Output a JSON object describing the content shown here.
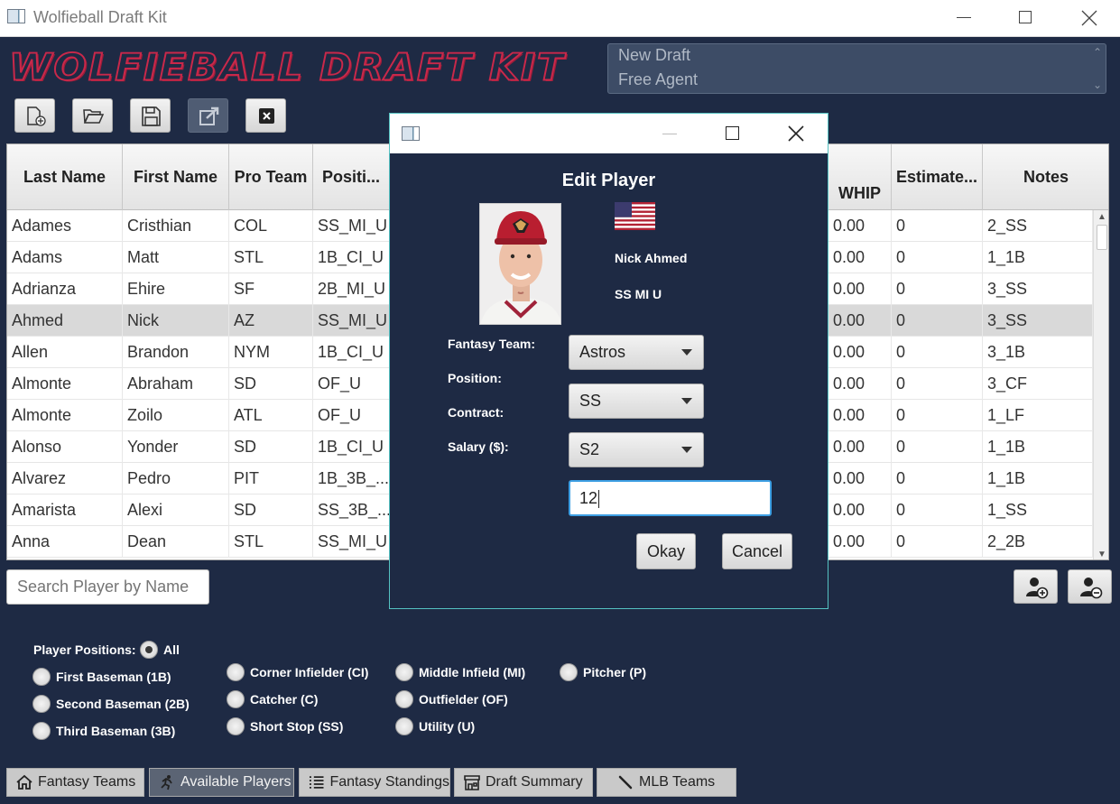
{
  "window": {
    "title": "Wolfieball Draft Kit"
  },
  "logo": {
    "text": "WOLFIEBALL DRAFT KIT"
  },
  "draft_list": {
    "items": [
      "New Draft",
      "Free Agent"
    ]
  },
  "toolbar": {
    "buttons": [
      "new-draft",
      "open-draft",
      "save-draft",
      "export-draft",
      "exit"
    ]
  },
  "table": {
    "headers": {
      "last_name": "Last Name",
      "first_name": "First Name",
      "pro_team": "Pro Team",
      "positions": "Positi...",
      "whip": "WHIP",
      "estimated": "Estimate...",
      "notes": "Notes"
    },
    "rows": [
      {
        "last": "Adames",
        "first": "Cristhian",
        "team": "COL",
        "pos": "SS_MI_U",
        "whip": "0.00",
        "est": "0",
        "notes": "2_SS"
      },
      {
        "last": "Adams",
        "first": "Matt",
        "team": "STL",
        "pos": "1B_CI_U",
        "whip": "0.00",
        "est": "0",
        "notes": "1_1B"
      },
      {
        "last": "Adrianza",
        "first": "Ehire",
        "team": "SF",
        "pos": "2B_MI_U",
        "whip": "0.00",
        "est": "0",
        "notes": "3_SS"
      },
      {
        "last": "Ahmed",
        "first": "Nick",
        "team": "AZ",
        "pos": "SS_MI_U",
        "whip": "0.00",
        "est": "0",
        "notes": "3_SS"
      },
      {
        "last": "Allen",
        "first": "Brandon",
        "team": "NYM",
        "pos": "1B_CI_U",
        "whip": "0.00",
        "est": "0",
        "notes": "3_1B"
      },
      {
        "last": "Almonte",
        "first": "Abraham",
        "team": "SD",
        "pos": "OF_U",
        "whip": "0.00",
        "est": "0",
        "notes": "3_CF"
      },
      {
        "last": "Almonte",
        "first": "Zoilo",
        "team": "ATL",
        "pos": "OF_U",
        "whip": "0.00",
        "est": "0",
        "notes": "1_LF"
      },
      {
        "last": "Alonso",
        "first": "Yonder",
        "team": "SD",
        "pos": "1B_CI_U",
        "whip": "0.00",
        "est": "0",
        "notes": "1_1B"
      },
      {
        "last": "Alvarez",
        "first": "Pedro",
        "team": "PIT",
        "pos": "1B_3B_...",
        "whip": "0.00",
        "est": "0",
        "notes": "1_1B"
      },
      {
        "last": "Amarista",
        "first": "Alexi",
        "team": "SD",
        "pos": "SS_3B_...",
        "whip": "0.00",
        "est": "0",
        "notes": "1_SS"
      },
      {
        "last": "Anna",
        "first": "Dean",
        "team": "STL",
        "pos": "SS_MI_U",
        "whip": "0.00",
        "est": "0",
        "notes": "2_2B"
      }
    ]
  },
  "search": {
    "placeholder": "Search Player by Name"
  },
  "filters": {
    "label": "Player Positions:",
    "options": [
      {
        "label": "All",
        "selected": true
      },
      {
        "label": "First Baseman (1B)",
        "selected": false
      },
      {
        "label": "Second Baseman (2B)",
        "selected": false
      },
      {
        "label": "Third Baseman (3B)",
        "selected": false
      },
      {
        "label": "Corner Infielder (CI)",
        "selected": false
      },
      {
        "label": "Catcher (C)",
        "selected": false
      },
      {
        "label": "Short Stop (SS)",
        "selected": false
      },
      {
        "label": "Middle Infield (MI)",
        "selected": false
      },
      {
        "label": "Outfielder (OF)",
        "selected": false
      },
      {
        "label": "Utility (U)",
        "selected": false
      },
      {
        "label": "Pitcher (P)",
        "selected": false
      }
    ]
  },
  "tabs": [
    {
      "label": "Fantasy Teams",
      "icon": "home-icon"
    },
    {
      "label": "Available Players",
      "icon": "runner-icon",
      "active": true
    },
    {
      "label": "Fantasy Standings",
      "icon": "list-icon"
    },
    {
      "label": "Draft Summary",
      "icon": "store-icon"
    },
    {
      "label": "MLB Teams",
      "icon": "bat-icon"
    }
  ],
  "dialog": {
    "title": "Edit Player",
    "player_name": "Nick Ahmed",
    "player_positions": "SS MI U",
    "labels": {
      "fantasy_team": "Fantasy Team:",
      "position": "Position:",
      "contract": "Contract:",
      "salary": "Salary ($):"
    },
    "fantasy_team_value": "Astros",
    "position_value": "SS",
    "contract_value": "S2",
    "salary_value": "12",
    "okay_label": "Okay",
    "cancel_label": "Cancel"
  },
  "colors": {
    "background": "#1e2a44",
    "logo_red": "#c9284a",
    "dialog_border": "#55c2c2",
    "focus_blue": "#3d9fe3"
  }
}
